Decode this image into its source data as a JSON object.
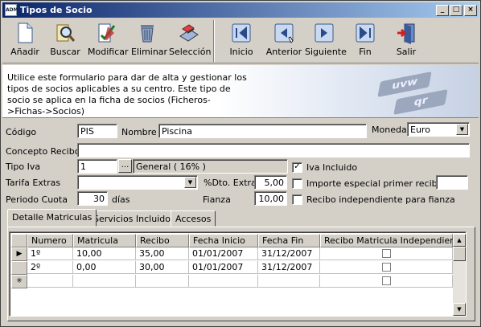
{
  "window": {
    "title": "Tipos de Socio",
    "app_icon_text": "ADM"
  },
  "toolbar": {
    "anadir": "Añadir",
    "buscar": "Buscar",
    "modificar": "Modificar",
    "eliminar": "Eliminar",
    "seleccion": "Selección",
    "inicio": "Inicio",
    "anterior": "Anterior",
    "siguiente": "Siguiente",
    "fin": "Fin",
    "salir": "Salir"
  },
  "banner": {
    "text": "Utilice este formulario para dar de alta y gestionar los tipos de socios aplicables a su centro. Este tipo de socio se aplica en la ficha de socios (Ficheros->Fichas->Socios)",
    "key1": "uvw",
    "key2": "qr"
  },
  "form": {
    "codigo_label": "Código",
    "codigo_value": "PIS",
    "nombre_label": "Nombre",
    "nombre_value": "Piscina",
    "moneda_label": "Moneda",
    "moneda_value": "Euro",
    "concepto_label": "Concepto Recibo",
    "concepto_value": "",
    "tipo_iva_label": "Tipo Iva",
    "tipo_iva_value": "1",
    "tipo_iva_btn": "...",
    "tipo_iva_desc": "General ( 16% )",
    "iva_incluido_label": "Iva Incluido",
    "iva_incluido_checked": true,
    "tarifa_label": "Tarifa Extras",
    "tarifa_value": "",
    "dto_label": "%Dto. Extras",
    "dto_value": "5,00",
    "importe_label": "Importe especial primer recibo",
    "importe_checked": false,
    "importe_value": "",
    "periodo_label": "Periodo Cuota",
    "periodo_value": "30",
    "dias_label": "días",
    "fianza_label": "Fianza",
    "fianza_value": "10,00",
    "recibo_indep_label": "Recibo independiente para fianza",
    "recibo_indep_checked": false
  },
  "tabs": [
    "Detalle Matriculas",
    "Servicios Incluidos",
    "Accesos"
  ],
  "grid": {
    "columns": [
      "Numero",
      "Matricula",
      "Recibo",
      "Fecha Inicio",
      "Fecha Fin",
      "Recibo Matricula Independiente"
    ],
    "rows": [
      {
        "numero": "1º",
        "matricula": "10,00",
        "recibo": "35,00",
        "fecha_inicio": "01/01/2007",
        "fecha_fin": "31/12/2007",
        "independiente": false
      },
      {
        "numero": "2º",
        "matricula": "0,00",
        "recibo": "30,00",
        "fecha_inicio": "01/01/2007",
        "fecha_fin": "31/12/2007",
        "independiente": false
      }
    ],
    "current_row_marker": "▶",
    "new_row_marker": "✳"
  },
  "colors": {
    "title_start": "#0a246a",
    "title_end": "#a6caf0",
    "face": "#d4d0c8"
  }
}
